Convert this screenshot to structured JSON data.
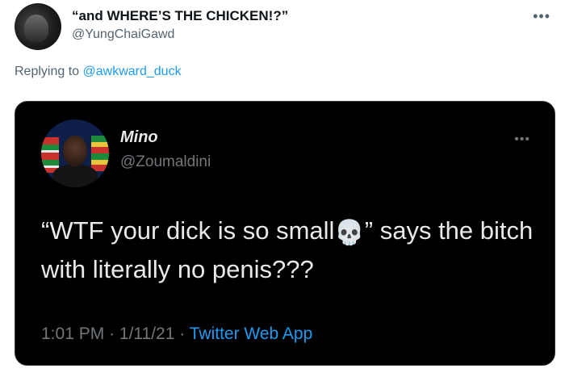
{
  "tweet": {
    "display_name": "“and WHERE’S THE CHICKEN!?”",
    "handle": "@YungChaiGawd",
    "more_icon": "more-horizontal-icon",
    "reply_prefix": "Replying to",
    "reply_mention": "@awkward_duck"
  },
  "quoted": {
    "display_name": "Mino",
    "handle": "@Zoumaldini",
    "text_before": "“WTF your dick is so small",
    "emoji": "💀",
    "text_after": "” says the bitch with literally no penis???",
    "time": "1:01 PM",
    "sep1": "·",
    "date": "1/11/21",
    "sep2": "·",
    "source": "Twitter Web App",
    "more_icon": "more-horizontal-icon"
  },
  "colors": {
    "link": "#1d9bf0",
    "secondary_text": "#536471",
    "card_background": "#000000"
  }
}
